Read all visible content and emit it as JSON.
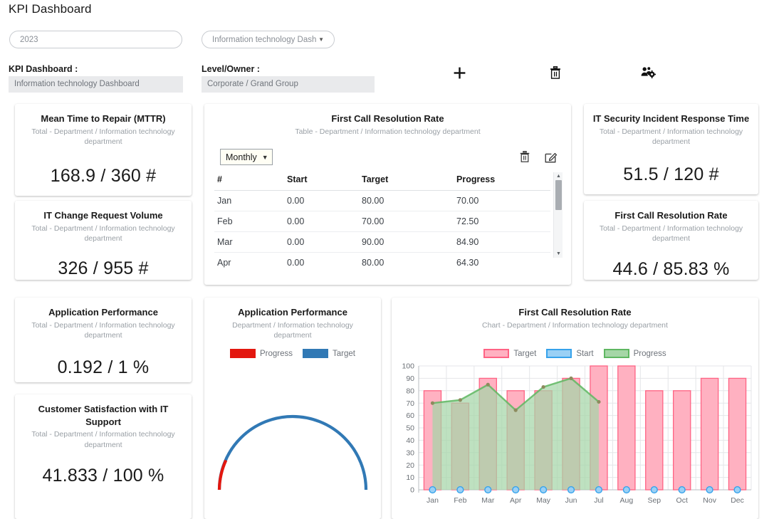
{
  "header": {
    "title": "KPI Dashboard",
    "year_value": "2023",
    "dashboard_select_value": "Information technology Dashb",
    "kpi_dashboard_label": "KPI Dashboard :",
    "kpi_dashboard_value": "Information technology Dashboard",
    "level_owner_label": "Level/Owner :",
    "level_owner_value": "Corporate / Grand Group",
    "icons": {
      "add": "plus-icon",
      "delete": "trash-icon",
      "share": "users-gear-icon"
    }
  },
  "cards": {
    "mttr": {
      "title": "Mean Time to Repair (MTTR)",
      "subtitle": "Total - Department / Information technology department",
      "value": "168.9 / 360 #"
    },
    "change_volume": {
      "title": "IT Change Request Volume",
      "subtitle": "Total - Department / Information technology department",
      "value": "326 / 955 #"
    },
    "app_perf_total": {
      "title": "Application Performance",
      "subtitle": "Total - Department / Information technology department",
      "value": "0.192 / 1 %"
    },
    "csat": {
      "title": "Customer Satisfaction with IT Support",
      "subtitle": "Total - Department / Information technology department",
      "value": "41.833 / 100 %"
    },
    "security_response": {
      "title": "IT Security Incident Response Time",
      "subtitle": "Total - Department / Information technology department",
      "value": "51.5 / 120 #"
    },
    "fcr_total": {
      "title": "First Call Resolution Rate",
      "subtitle": "Total - Department / Information technology department",
      "value": "44.6 / 85.83 %"
    }
  },
  "table_widget": {
    "title": "First Call Resolution Rate",
    "subtitle": "Table - Department / Information technology department",
    "period_value": "Monthly",
    "period_options": [
      "Monthly"
    ],
    "delete_icon": "trash-icon",
    "edit_icon": "edit-pencil-icon",
    "columns": [
      "#",
      "Start",
      "Target",
      "Progress"
    ],
    "rows": [
      {
        "month": "Jan",
        "start": "0.00",
        "target": "80.00",
        "progress": "70.00"
      },
      {
        "month": "Feb",
        "start": "0.00",
        "target": "70.00",
        "progress": "72.50"
      },
      {
        "month": "Mar",
        "start": "0.00",
        "target": "90.00",
        "progress": "84.90"
      },
      {
        "month": "Apr",
        "start": "0.00",
        "target": "80.00",
        "progress": "64.30"
      }
    ]
  },
  "gauge_widget": {
    "title": "Application Performance",
    "subtitle": "Department / Information technology department",
    "legend": [
      {
        "label": "Progress",
        "color": "#E3170F"
      },
      {
        "label": "Target",
        "color": "#3179B5"
      }
    ],
    "progress_fraction": 0.192,
    "target_fraction": 1
  },
  "chart_widget": {
    "title": "First Call Resolution Rate",
    "subtitle": "Chart - Department / Information technology department"
  },
  "chart_data": {
    "type": "bar",
    "title": "First Call Resolution Rate",
    "subtitle": "Chart - Department / Information technology department",
    "categories": [
      "Jan",
      "Feb",
      "Mar",
      "Apr",
      "May",
      "Jun",
      "Jul",
      "Aug",
      "Sep",
      "Oct",
      "Nov",
      "Dec"
    ],
    "series": [
      {
        "name": "Target",
        "type": "bar",
        "color": "#FFB1C1",
        "border": "#FF6384",
        "values": [
          80,
          70,
          90,
          80,
          80,
          90,
          100,
          100,
          80,
          80,
          90,
          90
        ]
      },
      {
        "name": "Start",
        "type": "point",
        "color": "#9AD0F5",
        "border": "#36A2EB",
        "values": [
          0,
          0,
          0,
          0,
          0,
          0,
          0,
          0,
          0,
          0,
          0,
          0
        ]
      },
      {
        "name": "Progress",
        "type": "area",
        "color": "#A5D6A7",
        "border": "#5FB762",
        "values": [
          70,
          72.5,
          84.9,
          64.3,
          83,
          90,
          71,
          null,
          null,
          null,
          null,
          null
        ]
      }
    ],
    "xlabel": "",
    "ylabel": "",
    "ylim": [
      0,
      100
    ],
    "yticks": [
      0,
      10,
      20,
      30,
      40,
      50,
      60,
      70,
      80,
      90,
      100
    ],
    "grid": true,
    "legend_position": "top"
  }
}
